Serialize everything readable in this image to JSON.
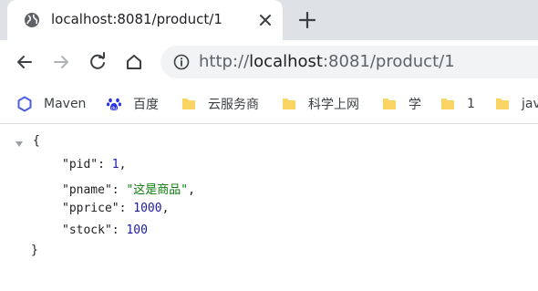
{
  "tab": {
    "title": "localhost:8081/product/1"
  },
  "toolbar": {
    "url_scheme": "http://",
    "url_host": "localhost",
    "url_rest": ":8081/product/1"
  },
  "bookmarks": [
    {
      "label": "Maven",
      "icon": "maven-hexagon-icon"
    },
    {
      "label": "百度",
      "icon": "baidu-paw-icon"
    },
    {
      "label": "云服务商",
      "icon": "folder-icon"
    },
    {
      "label": "科学上网",
      "icon": "folder-icon"
    },
    {
      "label": "学",
      "icon": "folder-icon"
    },
    {
      "label": "1",
      "icon": "folder-icon"
    },
    {
      "label": "java",
      "icon": "folder-icon"
    }
  ],
  "json": {
    "open": "{",
    "close": "}",
    "entries": [
      {
        "key": "\"pid\"",
        "value": "1"
      },
      {
        "key": "\"pname\"",
        "value": "\"这是商品\""
      },
      {
        "key": "\"pprice\"",
        "value": "1000"
      },
      {
        "key": "\"stock\"",
        "value": "100"
      }
    ]
  },
  "colors": {
    "string": "#0b7a0b",
    "number": "#1a1aa6",
    "folder": "#fbd564"
  }
}
